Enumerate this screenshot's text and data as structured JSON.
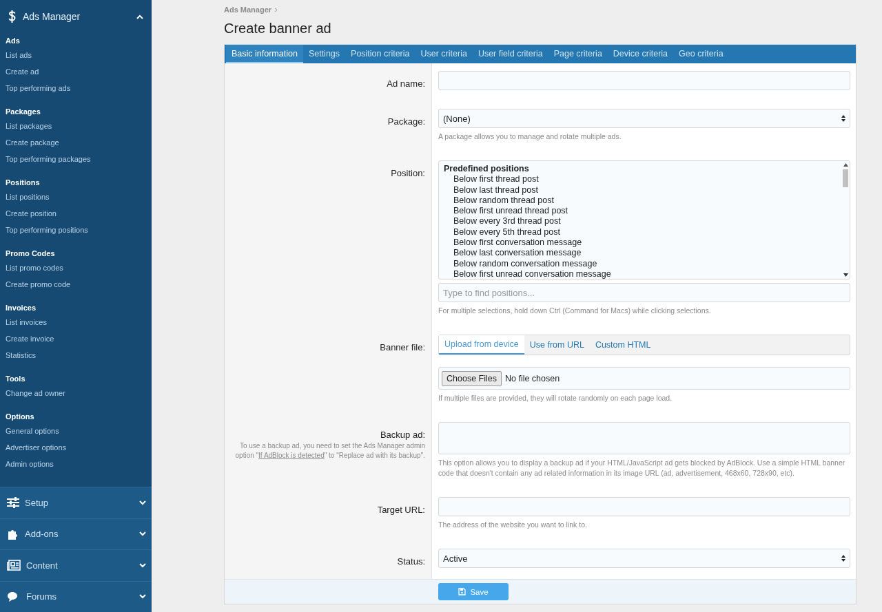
{
  "sidebar": {
    "header": {
      "label": "Ads Manager",
      "expanded": true
    },
    "groups": [
      {
        "title": "Ads",
        "items": [
          "List ads",
          "Create ad",
          "Top performing ads"
        ]
      },
      {
        "title": "Packages",
        "items": [
          "List packages",
          "Create package",
          "Top performing packages"
        ]
      },
      {
        "title": "Positions",
        "items": [
          "List positions",
          "Create position",
          "Top performing positions"
        ]
      },
      {
        "title": "Promo Codes",
        "items": [
          "List promo codes",
          "Create promo code"
        ]
      },
      {
        "title": "Invoices",
        "items": [
          "List invoices",
          "Create invoice",
          "Statistics"
        ]
      },
      {
        "title": "Tools",
        "items": [
          "Change ad owner"
        ]
      },
      {
        "title": "Options",
        "items": [
          "General options",
          "Advertiser options",
          "Admin options"
        ]
      }
    ],
    "sections": [
      {
        "label": "Setup",
        "expanded": false
      },
      {
        "label": "Add-ons",
        "expanded": false
      },
      {
        "label": "Content",
        "expanded": false
      },
      {
        "label": "Forums",
        "expanded": false
      }
    ]
  },
  "breadcrumb": "Ads Manager",
  "title": "Create banner ad",
  "tabs": [
    {
      "label": "Basic information",
      "selected": true
    },
    {
      "label": "Settings",
      "selected": false
    },
    {
      "label": "Position criteria",
      "selected": false
    },
    {
      "label": "User criteria",
      "selected": false
    },
    {
      "label": "User field criteria",
      "selected": false
    },
    {
      "label": "Page criteria",
      "selected": false
    },
    {
      "label": "Device criteria",
      "selected": false
    },
    {
      "label": "Geo criteria",
      "selected": false
    }
  ],
  "form": {
    "rows": [
      {
        "kind": "text",
        "label": "Ad name:"
      },
      {
        "kind": "select",
        "label": "Package:",
        "value": "(None)",
        "hint": "A package allows you to manage and rotate multiple ads."
      },
      {
        "kind": "listbox",
        "label": "Position:",
        "group": "Predefined positions",
        "options": [
          "Below first thread post",
          "Below last thread post",
          "Below random thread post",
          "Below first unread thread post",
          "Below every 3rd thread post",
          "Below every 5th thread post",
          "Below first conversation message",
          "Below last conversation message",
          "Below random conversation message",
          "Below first unread conversation message"
        ],
        "search_placeholder": "Type to find positions...",
        "hint": "For multiple selections, hold down Ctrl (Command for Macs) while clicking selections."
      },
      {
        "kind": "upload",
        "label": "Banner file:",
        "tabs": [
          {
            "label": "Upload from device",
            "selected": true
          },
          {
            "label": "Use from URL",
            "selected": false
          },
          {
            "label": "Custom HTML",
            "selected": false
          }
        ],
        "button": "Choose Files",
        "file_status": "No file chosen",
        "hint": "If multiple files are provided, they will rotate randomly on each page load."
      },
      {
        "kind": "textarea",
        "label": "Backup ad:",
        "explain_before": "To use a backup ad, you need to set the Ads Manager admin option \"",
        "explain_link": "If AdBlock is detected",
        "explain_after": "\" to \"Replace ad with its backup\".",
        "hint": "This option allows you to display a backup ad if your HTML/JavaScript ad gets blocked by AdBlock. Use a simple HTML banner code that doesn't contain any ad related information in its image URL (ad, advertisement, 468x60, 728x90, etc)."
      },
      {
        "kind": "text",
        "label": "Target URL:",
        "hint": "The address of the website you want to link to."
      },
      {
        "kind": "select",
        "label": "Status:",
        "value": "Active"
      }
    ],
    "save_button": "Save"
  }
}
